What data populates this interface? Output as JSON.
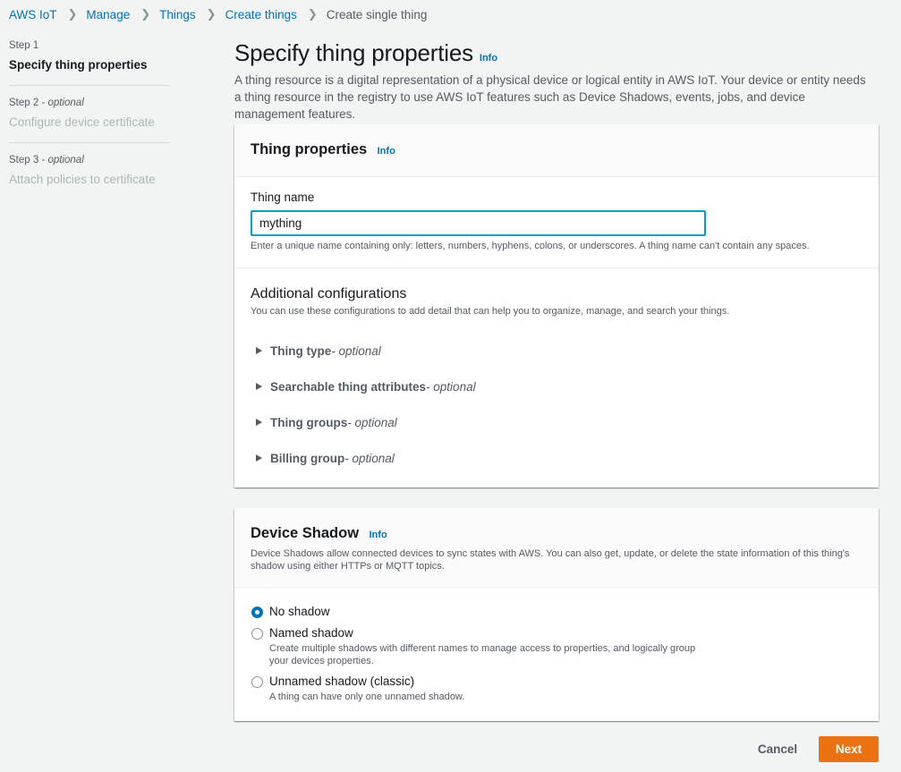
{
  "breadcrumb": {
    "items": [
      "AWS IoT",
      "Manage",
      "Things",
      "Create things"
    ],
    "current": "Create single thing"
  },
  "steps": [
    {
      "num": "Step 1",
      "optional": "",
      "title": "Specify thing properties",
      "active": true
    },
    {
      "num": "Step 2 - ",
      "optional": "optional",
      "title": "Configure device certificate",
      "active": false
    },
    {
      "num": "Step 3 - ",
      "optional": "optional",
      "title": "Attach policies to certificate",
      "active": false
    }
  ],
  "page": {
    "title": "Specify thing properties",
    "info": "Info",
    "description": "A thing resource is a digital representation of a physical device or logical entity in AWS IoT. Your device or entity needs a thing resource in the registry to use AWS IoT features such as Device Shadows, events, jobs, and device management features."
  },
  "thing_properties": {
    "title": "Thing properties",
    "info": "Info",
    "name_label": "Thing name",
    "name_value": "mything",
    "name_constraint": "Enter a unique name containing only: letters, numbers, hyphens, colons, or underscores. A thing name can't contain any spaces.",
    "additional_title": "Additional configurations",
    "additional_desc": "You can use these configurations to add detail that can help you to organize, manage, and search your things.",
    "expandables": [
      {
        "label": "Thing type",
        "suffix": " - optional"
      },
      {
        "label": "Searchable thing attributes",
        "suffix": " - optional"
      },
      {
        "label": "Thing groups",
        "suffix": " - optional"
      },
      {
        "label": "Billing group",
        "suffix": " - optional"
      }
    ]
  },
  "device_shadow": {
    "title": "Device Shadow",
    "info": "Info",
    "description": "Device Shadows allow connected devices to sync states with AWS. You can also get, update, or delete the state information of this thing's shadow using either HTTPs or MQTT topics.",
    "options": [
      {
        "label": "No shadow",
        "desc": "",
        "checked": true
      },
      {
        "label": "Named shadow",
        "desc": "Create multiple shadows with different names to manage access to properties, and logically group your devices properties.",
        "checked": false
      },
      {
        "label": "Unnamed shadow (classic)",
        "desc": "A thing can have only one unnamed shadow.",
        "checked": false
      }
    ]
  },
  "footer": {
    "cancel": "Cancel",
    "next": "Next"
  },
  "colors": {
    "accent": "#0073bb",
    "primary_button": "#ec7211",
    "focus_border": "#00a1c9"
  }
}
